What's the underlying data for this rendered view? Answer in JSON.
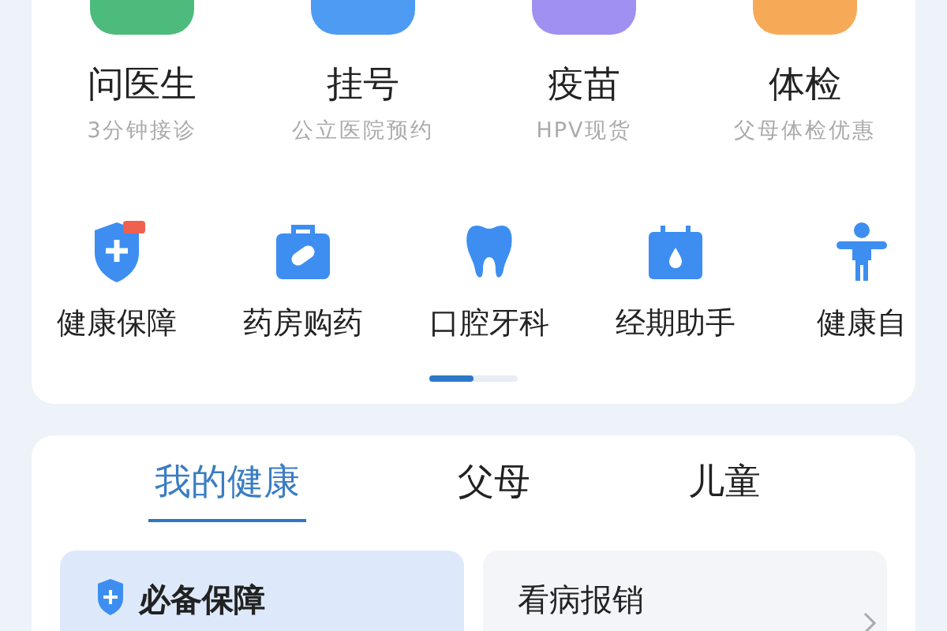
{
  "services": [
    {
      "title": "问医生",
      "subtitle": "3分钟接诊",
      "color": "#4dbb7c"
    },
    {
      "title": "挂号",
      "subtitle": "公立医院预约",
      "color": "#4d9bf2"
    },
    {
      "title": "疫苗",
      "subtitle": "HPV现货",
      "color": "#a090f2"
    },
    {
      "title": "体检",
      "subtitle": "父母体检优惠",
      "color": "#f6aa58"
    }
  ],
  "shortcuts": [
    {
      "kind": "shield",
      "label": "健康保障"
    },
    {
      "kind": "medkit",
      "label": "药房购药"
    },
    {
      "kind": "tooth",
      "label": "口腔牙科"
    },
    {
      "kind": "calendar",
      "label": "经期助手"
    },
    {
      "kind": "person",
      "label": "健康自"
    }
  ],
  "tabs": [
    {
      "label": "我的健康",
      "selected": true
    },
    {
      "label": "父母",
      "selected": false
    },
    {
      "label": "儿童",
      "selected": false
    }
  ],
  "panels": [
    {
      "kind": "primary",
      "title": "必备保障"
    },
    {
      "kind": "link",
      "title": "看病报销"
    }
  ]
}
